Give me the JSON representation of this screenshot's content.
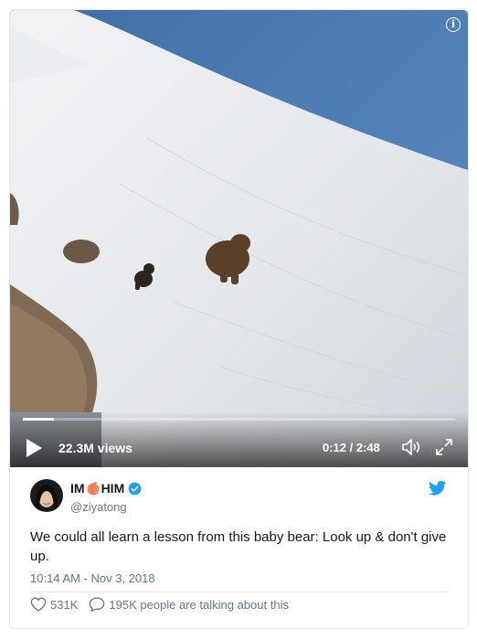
{
  "video": {
    "views": "22.3M views",
    "time": "0:12 / 2:48",
    "progress": 0.071
  },
  "icons": {
    "info": "info-icon",
    "play": "play-icon",
    "volume": "volume-icon",
    "fullscreen": "fullscreen-icon",
    "bird": "twitter-bird-icon",
    "verified": "verified-badge-icon",
    "like": "heart-icon",
    "reply": "reply-bubble-icon"
  },
  "tweet": {
    "name_part1": "IM",
    "name_emoji": "peach",
    "name_part2": "HIM",
    "handle": "@ziyatong",
    "text": "We could all learn a lesson from this baby bear: Look up & don't give up.",
    "timestamp": "10:14 AM - Nov 3, 2018",
    "likes": "531K",
    "talking": "195K people are talking about this"
  },
  "colors": {
    "twitter_blue": "#1da1f2",
    "text": "#14171a",
    "muted": "#657786"
  }
}
